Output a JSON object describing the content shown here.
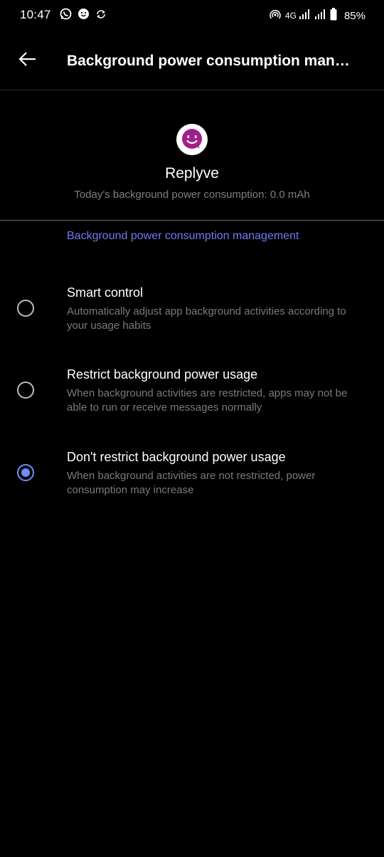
{
  "status_bar": {
    "time": "10:47",
    "left_icons": [
      "whatsapp-icon",
      "face-icon",
      "sync-icon"
    ],
    "network": "4G",
    "battery": "85%"
  },
  "header": {
    "title": "Background power consumption man…"
  },
  "app": {
    "name": "Replyve",
    "power_text": "Today's background power consumption: 0.0 mAh",
    "icon_color": "#a0208a"
  },
  "section": {
    "title": "Background power consumption management"
  },
  "options": [
    {
      "title": "Smart control",
      "description": "Automatically adjust app background activities according to your usage habits",
      "selected": false
    },
    {
      "title": "Restrict background power usage",
      "description": "When background activities are restricted, apps may not be able to run or receive messages normally",
      "selected": false
    },
    {
      "title": "Don't restrict background power usage",
      "description": "When background activities are not restricted, power consumption may increase",
      "selected": true
    }
  ],
  "colors": {
    "accent": "#6f7bf0",
    "radio_selected": "#6f8ef5",
    "background": "#000000"
  }
}
